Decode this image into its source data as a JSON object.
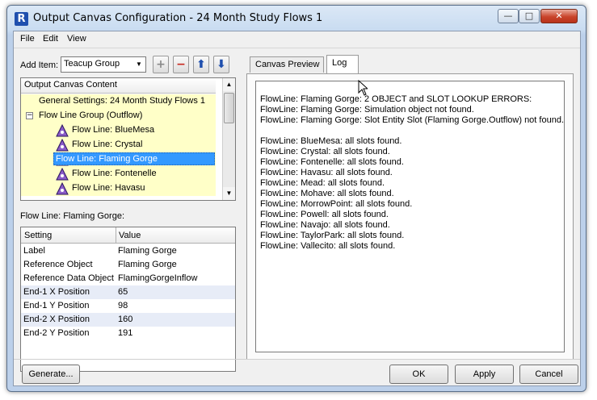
{
  "window": {
    "title": "Output Canvas Configuration - 24 Month Study Flows 1",
    "app_icon_glyph": "R"
  },
  "titlebar_buttons": {
    "minimize": "—",
    "maximize": "□",
    "close": "✕"
  },
  "menu": [
    "File",
    "Edit",
    "View"
  ],
  "add_item": {
    "label": "Add Item:",
    "selected": "Teacup Group"
  },
  "toolbar_glyphs": {
    "add": "+",
    "remove": "−",
    "up": "⬆",
    "down": "⬇"
  },
  "tree": {
    "header": "Output Canvas Content",
    "rows": [
      {
        "label": "General Settings: 24 Month Study Flows 1"
      },
      {
        "label": "Flow Line Group (Outflow)",
        "expander": "−"
      },
      {
        "label": "Flow Line: BlueMesa"
      },
      {
        "label": "Flow Line: Crystal"
      },
      {
        "label": "Flow Line: Flaming Gorge"
      },
      {
        "label": "Flow Line: Fontenelle"
      },
      {
        "label": "Flow Line: Havasu"
      }
    ]
  },
  "selected_label": "Flow Line: Flaming Gorge:",
  "settings_table": {
    "columns": [
      "Setting",
      "Value"
    ],
    "rows": [
      [
        "Label",
        "Flaming Gorge"
      ],
      [
        "Reference Object",
        "Flaming Gorge"
      ],
      [
        "Reference Data Object",
        "FlamingGorgeInflow"
      ],
      [
        "End-1 X Position",
        "65"
      ],
      [
        "End-1 Y Position",
        "98"
      ],
      [
        "End-2 X Position",
        "160"
      ],
      [
        "End-2 Y Position",
        "191"
      ]
    ]
  },
  "tabs": [
    "Canvas Preview",
    "Log"
  ],
  "log_lines": [
    "FlowLine: Flaming Gorge: 2 OBJECT and SLOT LOOKUP ERRORS:",
    "FlowLine: Flaming Gorge: Simulation object not found.",
    "FlowLine: Flaming Gorge: Slot Entity Slot (Flaming Gorge.Outflow) not found.",
    "",
    "FlowLine: BlueMesa: all slots found.",
    "FlowLine: Crystal: all slots found.",
    "FlowLine: Fontenelle: all slots found.",
    "FlowLine: Havasu: all slots found.",
    "FlowLine: Mead: all slots found.",
    "FlowLine: Mohave: all slots found.",
    "FlowLine: MorrowPoint: all slots found.",
    "FlowLine: Powell: all slots found.",
    "FlowLine: Navajo: all slots found.",
    "FlowLine: TaylorPark: all slots found.",
    "FlowLine: Vallecito: all slots found."
  ],
  "buttons": {
    "generate": "Generate...",
    "ok": "OK",
    "apply": "Apply",
    "cancel": "Cancel"
  },
  "colors": {
    "selection": "#3399ff",
    "tree_bg": "#ffffc8",
    "alt_row": "#e7ecf7",
    "icon_purple": "#8a5cc8"
  }
}
